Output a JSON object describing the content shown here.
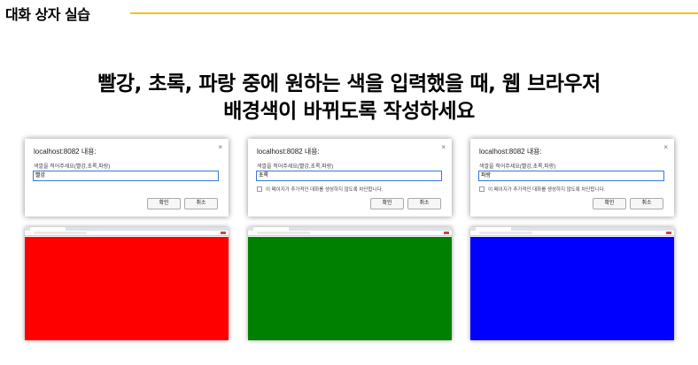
{
  "header": {
    "section_title": "대화 상자 실습",
    "accent_color": "#f2c318"
  },
  "headline": {
    "line1": "빨강, 초록, 파랑 중에 원하는 색을 입력했을 때, 웹 브라우저",
    "line2": "배경색이 바뀌도록 작성하세요"
  },
  "panels": [
    {
      "dialog": {
        "title": "localhost:8082 내용:",
        "close": "×",
        "prompt": "색깔을 적어주세요(빨강,초록,파랑)",
        "input_value": "빨강",
        "checkbox_label": "",
        "ok_label": "확인",
        "cancel_label": "취소"
      },
      "background_color": "#ff0000"
    },
    {
      "dialog": {
        "title": "localhost:8082 내용:",
        "close": "×",
        "prompt": "색깔을 적어주세요(빨강,초록,파랑)",
        "input_value": "초록",
        "checkbox_label": "이 페이지가 추가적인 대화를 생성하지 않도록 차단합니다.",
        "ok_label": "확인",
        "cancel_label": "취소"
      },
      "background_color": "#008000"
    },
    {
      "dialog": {
        "title": "localhost:8082 내용:",
        "close": "×",
        "prompt": "색깔을 적어주세요(빨강,초록,파랑)",
        "input_value": "파랑",
        "checkbox_label": "이 페이지가 추가적인 대화를 생성하지 않도록 차단합니다.",
        "ok_label": "확인",
        "cancel_label": "취소"
      },
      "background_color": "#0000ff"
    }
  ]
}
